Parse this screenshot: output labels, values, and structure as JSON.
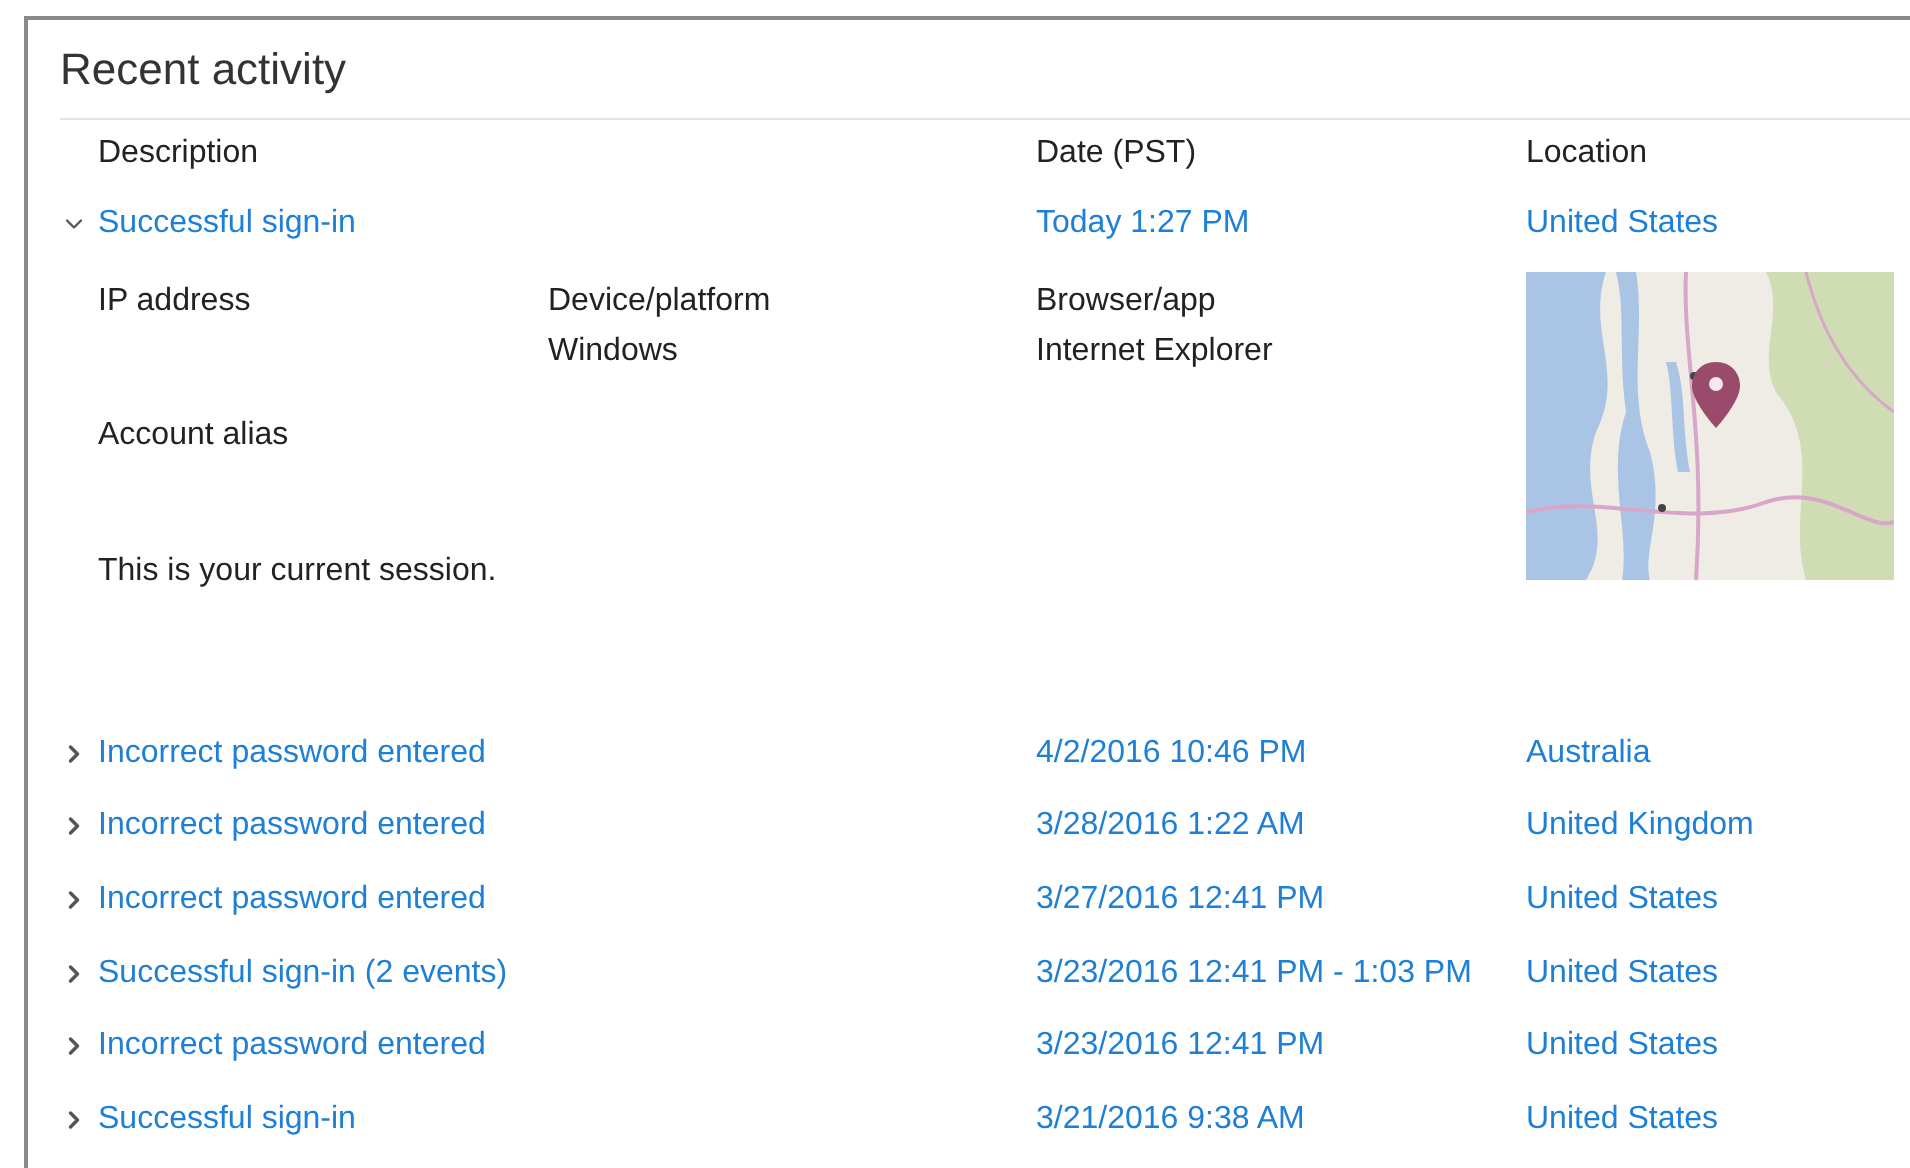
{
  "title": "Recent activity",
  "columns": [
    "Description",
    "Date (PST)",
    "Location"
  ],
  "events": [
    {
      "description": "Successful sign-in",
      "date": "Today 1:27 PM",
      "location": "United States",
      "expanded": true,
      "details": {
        "fields": [
          {
            "label": "IP address"
          },
          {
            "label": "Device/platform",
            "value": "Windows"
          },
          {
            "label": "Browser/app",
            "value": "Internet Explorer"
          }
        ],
        "alias_label": "Account alias",
        "note": "This is your current session."
      }
    },
    {
      "description": "Incorrect password entered",
      "date": "4/2/2016 10:46 PM",
      "location": "Australia",
      "expanded": false
    },
    {
      "description": "Incorrect password entered",
      "date": "3/28/2016 1:22 AM",
      "location": "United Kingdom",
      "expanded": false
    },
    {
      "description": "Incorrect password entered",
      "date": "3/27/2016 12:41 PM",
      "location": "United States",
      "expanded": false
    },
    {
      "description": "Successful sign-in (2 events)",
      "date": "3/23/2016 12:41 PM - 1:03 PM",
      "location": "United States",
      "expanded": false
    },
    {
      "description": "Incorrect password entered",
      "date": "3/23/2016 12:41 PM",
      "location": "United States",
      "expanded": false
    },
    {
      "description": "Successful sign-in",
      "date": "3/21/2016 9:38 AM",
      "location": "United States",
      "expanded": false
    }
  ]
}
